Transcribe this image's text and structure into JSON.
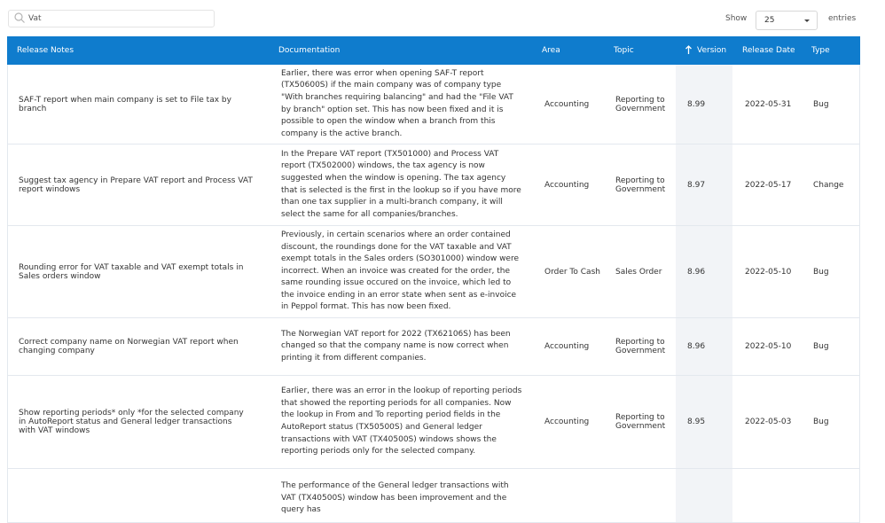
{
  "search": {
    "value": "Vat",
    "placeholder": ""
  },
  "pagination": {
    "show_label": "Show",
    "page_size": "25",
    "entries_label": "entries"
  },
  "columns": {
    "release_notes": "Release Notes",
    "documentation": "Documentation",
    "area": "Area",
    "topic": "Topic",
    "version": "Version",
    "release_date": "Release Date",
    "type": "Type"
  },
  "sort": {
    "column": "Version",
    "direction": "ascending"
  },
  "colors": {
    "header_bg": "#0f7ccd",
    "version_col_bg": "#f2f4f7"
  },
  "rows": [
    {
      "release_note": "SAF-T report when main company is set to File tax by branch",
      "documentation": "Earlier, there was error when opening SAF-T report (TX50600S) if the main company was of company type \"With branches requiring balancing\" and had the \"File VAT by branch\" option set. This has now been fixed and it is possible to open the window when a branch from this company is the active branch.",
      "area": "Accounting",
      "topic": "Reporting to Government",
      "version": "8.99",
      "release_date": "2022-05-31",
      "type": "Bug"
    },
    {
      "release_note": "Suggest tax agency in Prepare VAT report and Process VAT report windows",
      "documentation": "In the Prepare VAT report (TX501000) and Process VAT report (TX502000) windows, the tax agency is now suggested when the window is opening. The tax agency that is selected is the first in the lookup so if you have more than one tax supplier in a multi-branch company, it will select the same for all companies/branches.",
      "area": "Accounting",
      "topic": "Reporting to Government",
      "version": "8.97",
      "release_date": "2022-05-17",
      "type": "Change"
    },
    {
      "release_note": "Rounding error for VAT taxable and VAT exempt totals in Sales orders window",
      "documentation": "Previously, in certain scenarios where an order contained discount, the roundings done for the VAT taxable and VAT exempt totals in the Sales orders (SO301000) window were incorrect. When an invoice was created for the order, the same rounding issue occured on the invoice, which led to the invoice ending in an error state when sent as e-invoice in Peppol format. This has now been fixed.",
      "area": "Order To Cash",
      "topic": "Sales Order",
      "version": "8.96",
      "release_date": "2022-05-10",
      "type": "Bug"
    },
    {
      "release_note": "Correct company name on Norwegian VAT report when changing company",
      "documentation": "The Norwegian VAT report for 2022 (TX62106S) has been changed so that the company name is now correct when printing it from different companies.",
      "area": "Accounting",
      "topic": "Reporting to Government",
      "version": "8.96",
      "release_date": "2022-05-10",
      "type": "Bug"
    },
    {
      "release_note": "Show reporting periods* only *for the selected company in AutoReport status and General ledger transactions with VAT windows",
      "documentation": "Earlier, there was an error in the lookup of reporting periods that showed the reporting periods for all companies. Now the lookup in From and To reporting period fields in the AutoReport status (TX50500S) and General ledger transactions with VAT (TX40500S) windows shows the reporting periods only for the selected company.",
      "area": "Accounting",
      "topic": "Reporting to Government",
      "version": "8.95",
      "release_date": "2022-05-03",
      "type": "Bug"
    },
    {
      "release_note": "",
      "documentation": "The performance of the General ledger transactions with VAT (TX40500S) window has been improvement and the query has",
      "area": "",
      "topic": "",
      "version": "",
      "release_date": "",
      "type": ""
    }
  ]
}
